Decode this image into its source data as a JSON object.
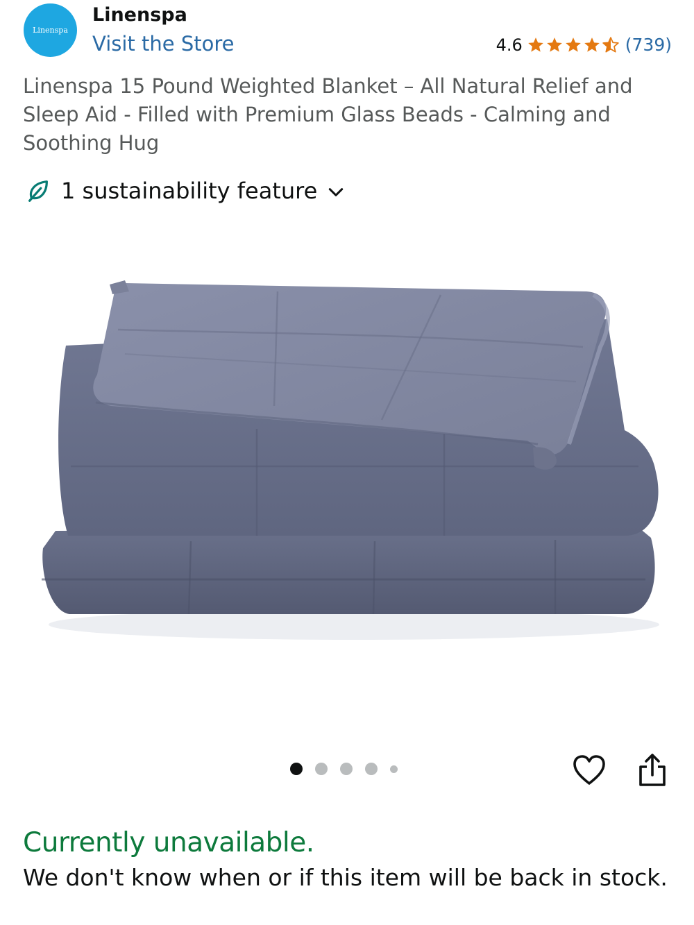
{
  "store": {
    "logo_text": "Linenspa",
    "brand_name": "Linenspa",
    "visit_label": "Visit the Store"
  },
  "rating": {
    "value": "4.6",
    "stars": 4.5,
    "count": "(739)",
    "star_color": "#e47911"
  },
  "product": {
    "title": "Linenspa 15 Pound Weighted Blanket – All Natural Relief and Sleep Aid - Filled with Premium Glass Beads - Calming and Soothing Hug",
    "image_icon": "folded-weighted-blanket-image",
    "blanket_color": "#6e7590"
  },
  "sustainability": {
    "label": "1 sustainability feature",
    "icon": "leaf-icon",
    "accent": "#087c74"
  },
  "carousel": {
    "total_dots": 5,
    "active_index": 0
  },
  "actions": {
    "wishlist_icon": "heart-icon",
    "share_icon": "share-icon"
  },
  "availability": {
    "status": "Currently unavailable.",
    "status_color": "#0d7a3c",
    "note": "We don't know when or if this item will be back in stock."
  }
}
